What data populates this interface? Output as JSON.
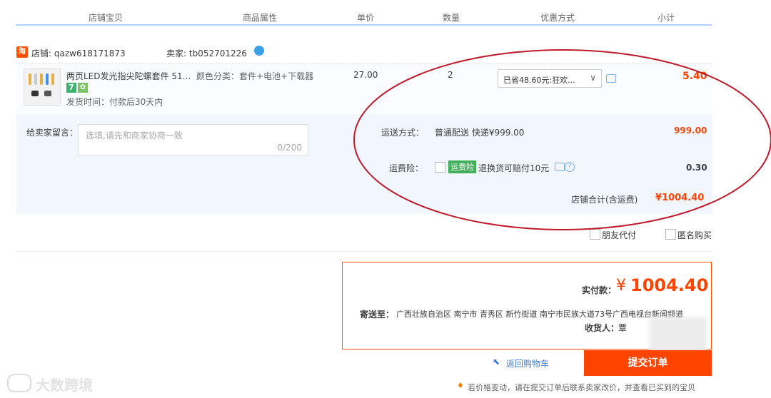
{
  "header": {
    "col_item": "店铺宝贝",
    "col_attr": "商品属性",
    "col_price": "单价",
    "col_qty": "数量",
    "col_promo": "优惠方式",
    "col_subtotal": "小计"
  },
  "shop": {
    "logo_text": "淘",
    "shop_label": "店铺: qazw618171873",
    "seller_label": "卖家: tb052701226"
  },
  "item": {
    "title": "两页LED发光指尖陀螺套件 51...",
    "color_attr": "颜色分类：套件+电池+下载器",
    "badge_seven": "7",
    "ship_time": "发货时间：付款后30天内",
    "unit_price": "27.00",
    "quantity": "2",
    "promo": "已省48.60元:狂欢...",
    "subtotal": "5.40"
  },
  "options": {
    "message_label": "给卖家留言：",
    "message_placeholder": "选填,请先和商家协商一致",
    "message_counter": "0/200",
    "delivery_label": "运送方式：",
    "delivery_value": "普通配送 快递¥999.00",
    "delivery_fee": "999.00",
    "insurance_label": "运费险：",
    "insurance_tag": "运费险",
    "insurance_desc": "退换货可赔付10元",
    "insurance_fee": "0.30",
    "shop_total_label": "店铺合计(含运费)",
    "shop_total": "¥1004.40"
  },
  "checkboxes": {
    "friend_pay": "朋友代付",
    "anonymous": "匿名购买"
  },
  "payment": {
    "actual_label": "实付款：",
    "currency": "¥",
    "amount": "1004.40",
    "address_label": "寄送至：",
    "address": "广西壮族自治区 南宁市 青秀区 新竹街道 南宁市民族大道73号广西电视台新闻频道",
    "receiver_label": "收货人：",
    "receiver": "覃"
  },
  "actions": {
    "back_to_cart": "返回购物车",
    "submit": "提交订单",
    "price_notice": "若价格变动，请在提交订单后联系卖家改价，并查看已买到的宝贝"
  },
  "watermark": "大数跨境",
  "colors": {
    "accent": "#ff4400",
    "header_line": "#b2d1ff",
    "annotation": "#c0192a"
  }
}
